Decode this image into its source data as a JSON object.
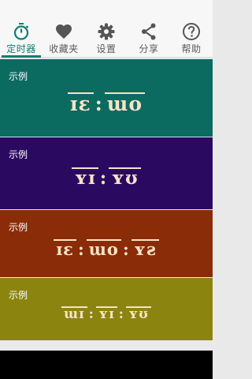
{
  "tabs": [
    {
      "label": "定时器",
      "icon": "stopwatch-icon",
      "active": true
    },
    {
      "label": "收藏夹",
      "icon": "heart-icon",
      "active": false
    },
    {
      "label": "设置",
      "icon": "gear-icon",
      "active": false
    },
    {
      "label": "分享",
      "icon": "share-icon",
      "active": false
    },
    {
      "label": "帮助",
      "icon": "help-icon",
      "active": false
    }
  ],
  "colors": {
    "accent": "#0d7d73",
    "card_1": "#0b6b61",
    "card_2": "#2a0a61",
    "card_3": "#8a2c08",
    "card_4": "#8b8510",
    "clock_text": "#f8e2c7"
  },
  "cards": [
    {
      "title": "示例",
      "clock": [
        "ɪɛ",
        "ɯo"
      ]
    },
    {
      "title": "示例",
      "clock": [
        "ʏɪ",
        "ʏʊ"
      ]
    },
    {
      "title": "示例",
      "clock": [
        "ɪɛ",
        "ɯo",
        "ʏƨ"
      ]
    },
    {
      "title": "示例",
      "clock": [
        "ɯɪ",
        "ʏɪ",
        "ʏʊ"
      ]
    }
  ]
}
